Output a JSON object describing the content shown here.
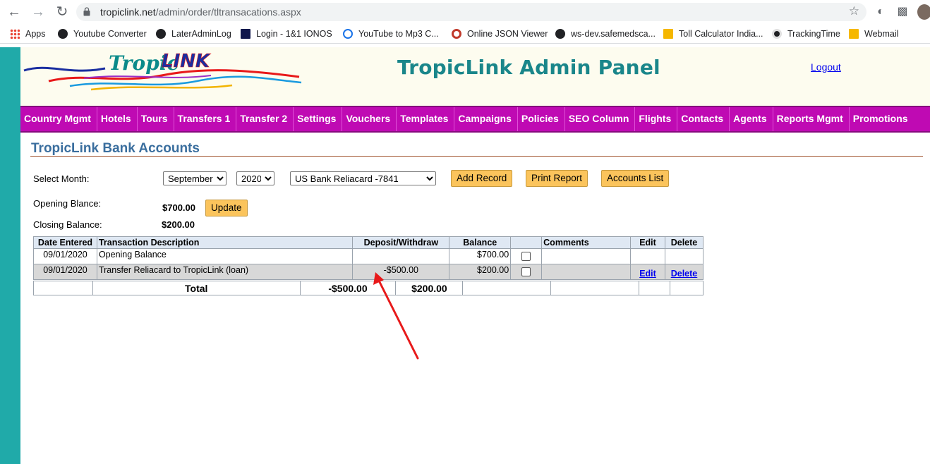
{
  "browser": {
    "url_domain": "tropiclink.net",
    "url_path": "/admin/order/tltransacations.aspx",
    "bookmarks": [
      {
        "label": "Apps",
        "icon": "apps-grid-icon"
      },
      {
        "label": "Youtube Converter",
        "icon": "globe-icon"
      },
      {
        "label": "LaterAdminLog",
        "icon": "globe-icon"
      },
      {
        "label": "Login - 1&1 IONOS",
        "icon": "ionos-icon"
      },
      {
        "label": "YouTube to Mp3 C...",
        "icon": "cloud-download-icon"
      },
      {
        "label": "Online JSON Viewer",
        "icon": "json-viewer-icon"
      },
      {
        "label": "ws-dev.safemedsca...",
        "icon": "globe-icon"
      },
      {
        "label": "Toll Calculator India...",
        "icon": "toll-icon"
      },
      {
        "label": "TrackingTime",
        "icon": "trackingtime-icon"
      },
      {
        "label": "Webmail",
        "icon": "mail-icon"
      }
    ]
  },
  "header": {
    "title": "TropicLink Admin Panel",
    "logout": "Logout",
    "logo_text_1": "Tropic",
    "logo_text_2": "LINK"
  },
  "menu": [
    "Country Mgmt",
    "Hotels",
    "Tours",
    "Transfers 1",
    "Transfer 2",
    "Settings",
    "Vouchers",
    "Templates",
    "Campaigns",
    "Policies",
    "SEO Column",
    "Flights",
    "Contacts",
    "Agents",
    "Reports Mgmt",
    "Promotions"
  ],
  "page": {
    "title": "TropicLink Bank Accounts",
    "select_month_label": "Select Month:",
    "month": "September",
    "year": "2020",
    "account": "US Bank Reliacard -7841",
    "add_record": "Add Record",
    "print_report": "Print Report",
    "accounts_list": "Accounts List",
    "opening_label": "Opening Blance:",
    "opening_value": "$700.00",
    "update": "Update",
    "closing_label": "Closing Balance:",
    "closing_value": "$200.00"
  },
  "table": {
    "headers": [
      "Date Entered",
      "Transaction Description",
      "Deposit/Withdraw",
      "Balance",
      "",
      "Comments",
      "Edit",
      "Delete"
    ],
    "rows": [
      {
        "date": "09/01/2020",
        "desc": "Opening Balance",
        "amount": "",
        "balance": "$700.00",
        "comments": "",
        "edit": "",
        "delete": ""
      },
      {
        "date": "09/01/2020",
        "desc": "Transfer Reliacard to TropicLink (loan)",
        "amount": "-$500.00",
        "balance": "$200.00",
        "comments": "",
        "edit": "Edit",
        "delete": "Delete"
      }
    ],
    "total_label": "Total",
    "total_amount": "-$500.00",
    "total_balance": "$200.00"
  },
  "colors": {
    "teal_bar": "#20aaa9",
    "menu_bg": "#bf0ab3",
    "title_teal": "#1a868a",
    "button_orange": "#fbc45c",
    "arrow_red": "#e8191a"
  }
}
